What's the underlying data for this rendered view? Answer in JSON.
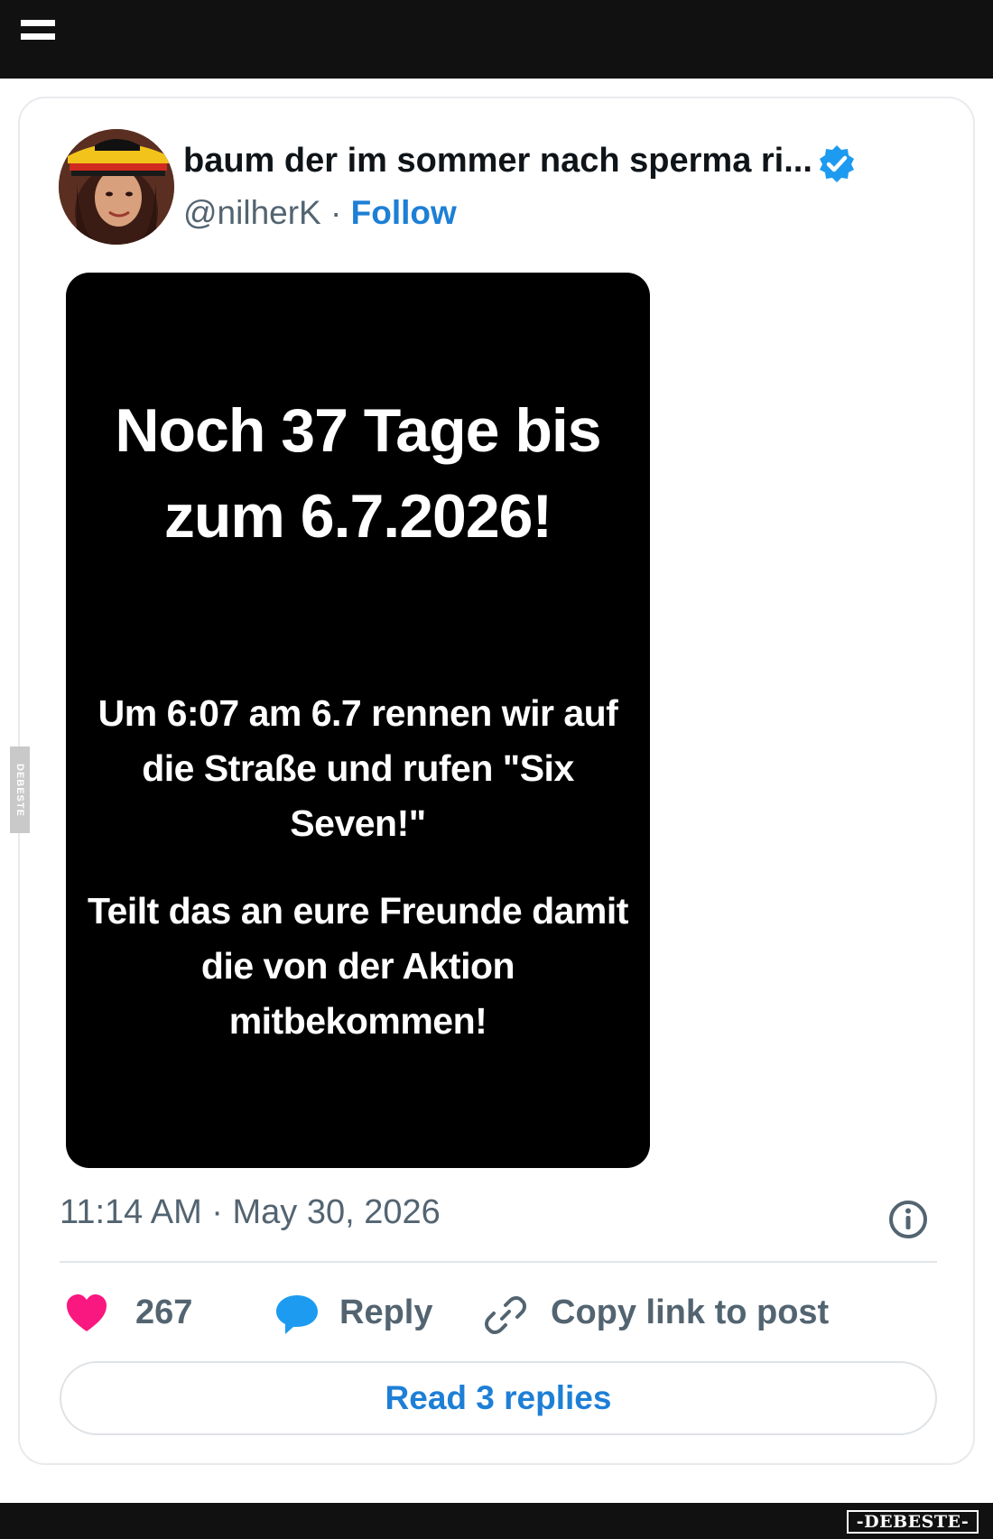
{
  "header": {
    "menu_icon": "hamburger-menu-icon"
  },
  "post": {
    "author": {
      "display_name": "baum der im sommer nach sperma ri...",
      "handle": "@nilherK",
      "separator": "·",
      "follow_label": "Follow",
      "verified_icon": "verified-badge-icon",
      "verified_color": "#1d9bf0"
    },
    "media": {
      "heading": "Noch 37 Tage bis zum 6.7.2026!",
      "paragraph1": "Um 6:07 am 6.7 rennen wir auf die Straße und rufen \"Six Seven!\"",
      "paragraph2": "Teilt das an eure Freunde damit die von der Aktion mitbekommen!"
    },
    "timestamp": "11:14 AM · May 30, 2026",
    "info_icon": "info-icon",
    "actions": {
      "likes_count": "267",
      "like_color": "#f91880",
      "reply_label": "Reply",
      "reply_color": "#1d9bf0",
      "copy_link_label": "Copy link to post"
    },
    "read_replies_label": "Read 3 replies",
    "accent_color": "#1d7fd6"
  },
  "watermark": {
    "side_text": "DEBESTE",
    "brand_logo": "-DEBESTE-"
  }
}
